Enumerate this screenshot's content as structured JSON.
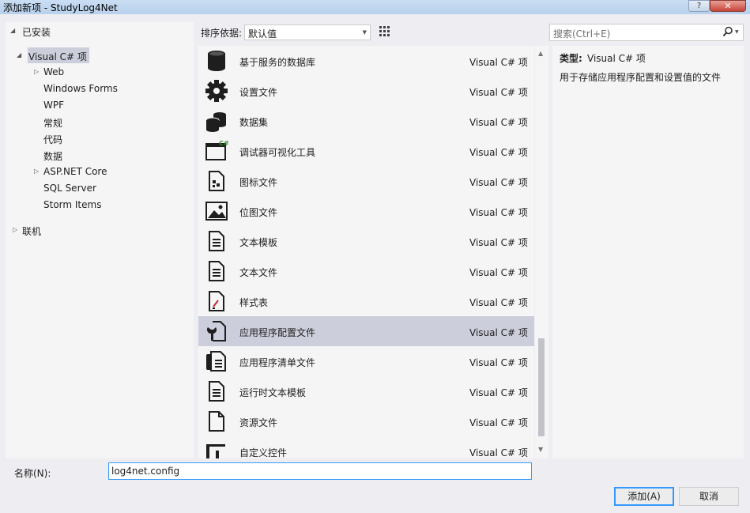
{
  "window": {
    "title": "添加新项 - StudyLog4Net",
    "help": "?",
    "close": "✕"
  },
  "tree": {
    "installed": "已安装",
    "visual_csharp": "Visual C# 项",
    "items": [
      "Web",
      "Windows Forms",
      "WPF",
      "常规",
      "代码",
      "数据",
      "ASP.NET Core",
      "SQL Server",
      "Storm Items"
    ],
    "online": "联机"
  },
  "toolbar": {
    "sort_label": "排序依据:",
    "sort_value": "默认值"
  },
  "search": {
    "placeholder": "搜索(Ctrl+E)"
  },
  "items": [
    {
      "name": "基于服务的数据库",
      "type": "Visual C# 项",
      "icon": "database-icon"
    },
    {
      "name": "设置文件",
      "type": "Visual C# 项",
      "icon": "gear-icon"
    },
    {
      "name": "数据集",
      "type": "Visual C# 项",
      "icon": "dataset-icon"
    },
    {
      "name": "调试器可视化工具",
      "type": "Visual C# 项",
      "icon": "visualizer-icon"
    },
    {
      "name": "图标文件",
      "type": "Visual C# 项",
      "icon": "icon-file-icon"
    },
    {
      "name": "位图文件",
      "type": "Visual C# 项",
      "icon": "bitmap-icon"
    },
    {
      "name": "文本模板",
      "type": "Visual C# 项",
      "icon": "text-template-icon"
    },
    {
      "name": "文本文件",
      "type": "Visual C# 项",
      "icon": "text-file-icon"
    },
    {
      "name": "样式表",
      "type": "Visual C# 项",
      "icon": "stylesheet-icon"
    },
    {
      "name": "应用程序配置文件",
      "type": "Visual C# 项",
      "icon": "config-file-icon"
    },
    {
      "name": "应用程序清单文件",
      "type": "Visual C# 项",
      "icon": "manifest-icon"
    },
    {
      "name": "运行时文本模板",
      "type": "Visual C# 项",
      "icon": "runtime-template-icon"
    },
    {
      "name": "资源文件",
      "type": "Visual C# 项",
      "icon": "resource-file-icon"
    },
    {
      "name": "自定义控件",
      "type": "Visual C# 项",
      "icon": "custom-control-icon"
    }
  ],
  "detail": {
    "type_label": "类型:",
    "type_value": "Visual C# 项",
    "description": "用于存储应用程序配置和设置值的文件"
  },
  "name_field": {
    "label": "名称(N):",
    "value": "log4net.config"
  },
  "buttons": {
    "add": "添加(A)",
    "cancel": "取消"
  },
  "colors": {
    "selection": "#cccedb",
    "accent": "#3399ff"
  }
}
